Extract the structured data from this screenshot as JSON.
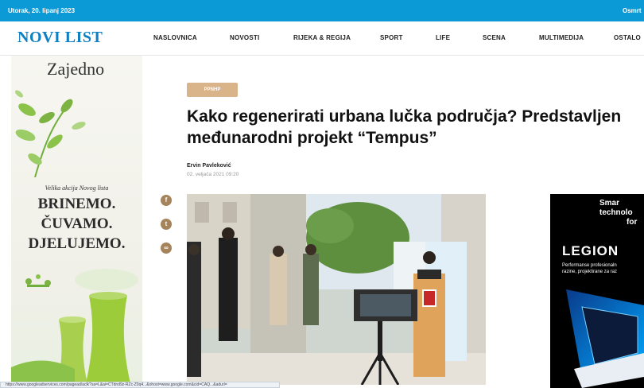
{
  "topbar": {
    "date": "Utorak, 20. lipanj 2023",
    "right": "Osmrt"
  },
  "brand": {
    "logo": "NOVI LIST",
    "color": "#0d7fc2"
  },
  "nav": [
    {
      "label": "NASLOVNICA"
    },
    {
      "label": "NOVOSTI"
    },
    {
      "label": "RIJEKA & REGIJA"
    },
    {
      "label": "SPORT"
    },
    {
      "label": "LIFE"
    },
    {
      "label": "SCENA"
    },
    {
      "label": "MULTIMEDIJA"
    },
    {
      "label": "OSTALO"
    }
  ],
  "left_ad": {
    "top_word": "Zajedno",
    "campaign": "Velika akcija Novog lista",
    "lines": [
      "BRINEMO.",
      "ČUVAMO.",
      "DJELUJEMO."
    ]
  },
  "article": {
    "category": "PPNHP",
    "title": "Kako regenerirati urbana lučka područja? Predstavljen međunarodni projekt “Tempus”",
    "author": "Ervin Pavleković",
    "date": "02. veljača 2021 09:20"
  },
  "share": [
    {
      "icon": "facebook-icon",
      "glyph": "f"
    },
    {
      "icon": "twitter-icon",
      "glyph": "t"
    },
    {
      "icon": "link-icon",
      "glyph": "∞"
    }
  ],
  "right_ad": {
    "line1": "Smar",
    "line2": "technolo",
    "line3": "for",
    "brand": "LEGION",
    "desc1": "Performanse profesionaln",
    "desc2": "razine, projektirane za raz"
  },
  "status_url": "https://www.googleadservices.com/pagead/aclk?sa=L&ai=CTdnd9z-RZc-Z0q4...&ohost=www.google.com&cid=CAQ...&adurl=",
  "colors": {
    "topbar": "#0c9ad6",
    "category": "#d9b38a",
    "share": "#a5835b"
  }
}
